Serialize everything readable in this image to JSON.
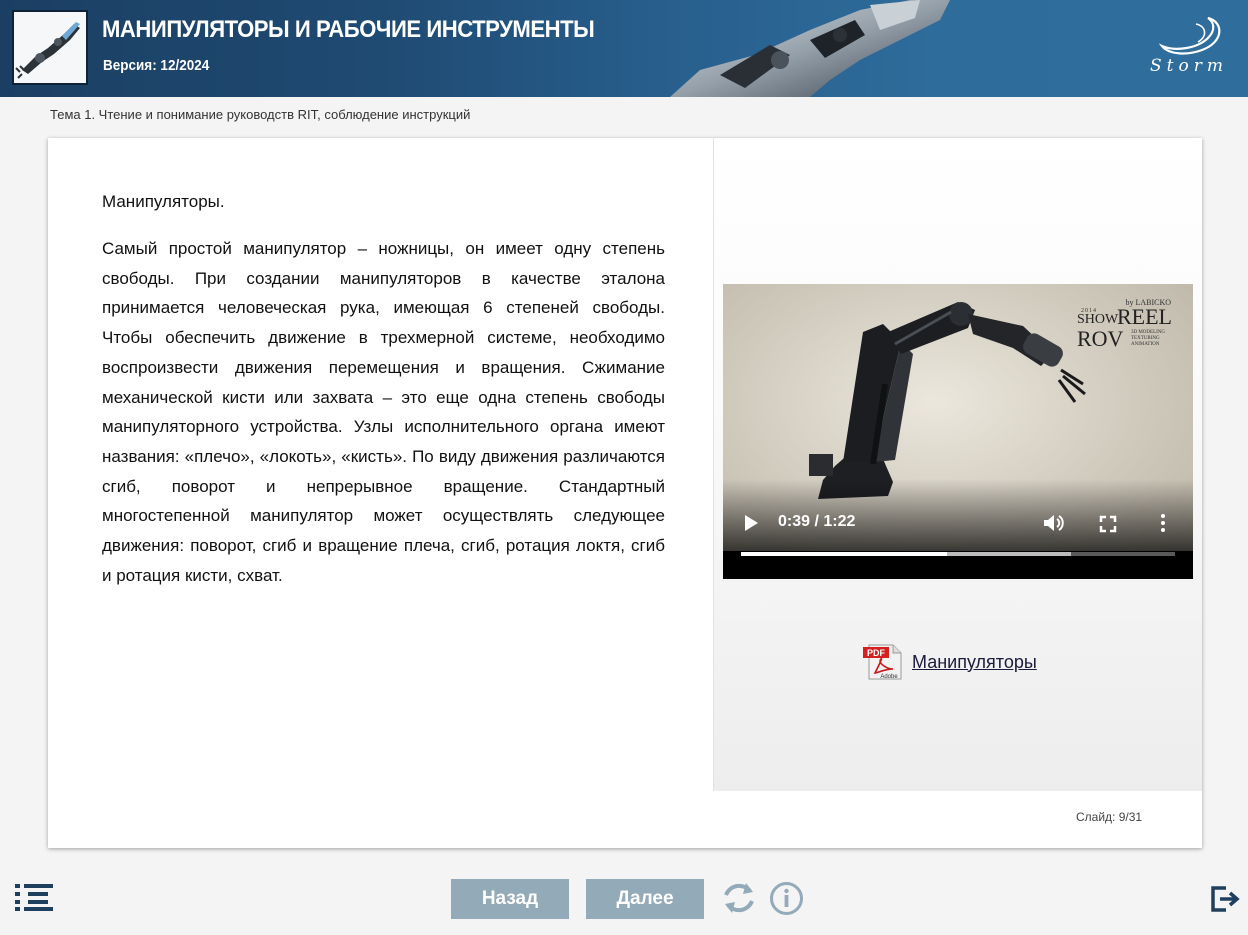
{
  "header": {
    "title": "МАНИПУЛЯТОРЫ И РАБОЧИЕ ИНСТРУМЕНТЫ",
    "version": "Версия: 12/2024",
    "logo_text": "Storm"
  },
  "topic": "Тема 1. Чтение и понимание руководств RIT, соблюдение инструкций",
  "slide": {
    "heading": "Манипуляторы.",
    "body": "Самый простой манипулятор – ножницы, он имеет одну степень свободы. При создании манипуляторов в качестве эталона принимается человеческая рука, имеющая 6 степеней свободы. Чтобы обеспечить движение в трехмерной системе, необходимо воспроизвести движения перемещения и вращения. Сжимание механической кисти или захвата – это еще одна степень свободы манипуляторного устройства. Узлы исполнительного органа имеют названия: «плечо», «локоть», «кисть». По виду движения различаются сгиб, поворот и непрерывное вращение. Стандартный многостепенной манипулятор может осуществлять следующее движения: поворот, сгиб и вращение плеча, сгиб, ротация локтя, сгиб и ротация кисти, схват."
  },
  "video": {
    "time": "0:39 / 1:22",
    "progress": 0.4756,
    "buffered": 0.76,
    "overlay": {
      "by": "by LABICKO",
      "year": "2014",
      "show": "SHOW",
      "reel": "REEL",
      "rov": "ROV",
      "sub1": "3D MODELING",
      "sub2": "TEXTURING",
      "sub3": "ANIMATION"
    }
  },
  "pdf": {
    "badge": "PDF",
    "brand": "Adobe",
    "label": "Манипуляторы"
  },
  "slide_counter": "Слайд: 9/31",
  "footer": {
    "back_label": "Назад",
    "next_label": "Далее"
  },
  "colors": {
    "header_bg": "#1f4a72",
    "nav_button": "#93aab9",
    "icon_dark": "#1f3f5e"
  },
  "icons": [
    "menu-icon",
    "reload-icon",
    "info-icon",
    "exit-icon",
    "play-icon",
    "volume-icon",
    "fullscreen-icon",
    "more-icon",
    "pdf-icon"
  ]
}
